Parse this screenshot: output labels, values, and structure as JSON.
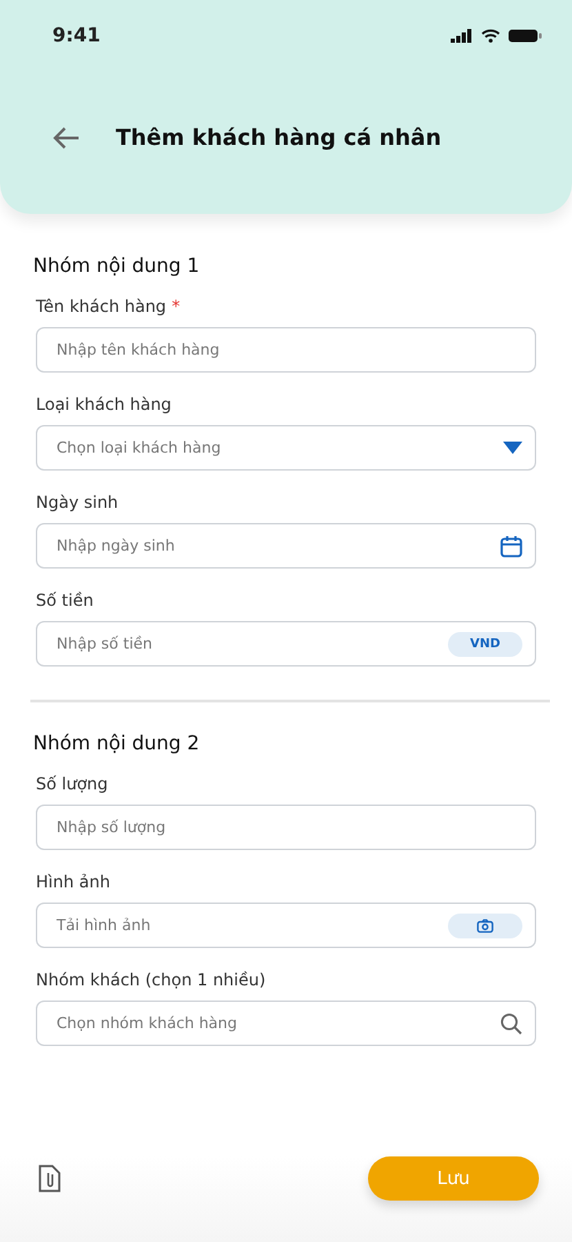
{
  "status_bar": {
    "time": "9:41"
  },
  "header": {
    "title": "Thêm khách hàng cá nhân"
  },
  "sections": [
    {
      "title": "Nhóm nội dung 1",
      "fields": [
        {
          "kind": "text",
          "label": "Tên khách hàng",
          "required_mark": "*",
          "placeholder": "Nhập tên khách hàng"
        },
        {
          "kind": "dropdown",
          "label": "Loại khách hàng",
          "placeholder": "Chọn loại khách hàng"
        },
        {
          "kind": "date",
          "label": "Ngày sinh",
          "placeholder": "Nhập ngày sinh"
        },
        {
          "kind": "currency",
          "label": "Số tiền",
          "placeholder": "Nhập số tiền",
          "unit": "VND"
        }
      ]
    },
    {
      "title": "Nhóm nội dung 2",
      "fields": [
        {
          "kind": "text",
          "label": "Số lượng",
          "placeholder": "Nhập số lượng"
        },
        {
          "kind": "image",
          "label": "Hình ảnh",
          "placeholder": "Tải hình ảnh"
        },
        {
          "kind": "search",
          "label": "Nhóm khách (chọn 1 nhiều)",
          "placeholder": "Chọn nhóm khách hàng"
        }
      ]
    }
  ],
  "footer": {
    "button": "Lưu"
  }
}
